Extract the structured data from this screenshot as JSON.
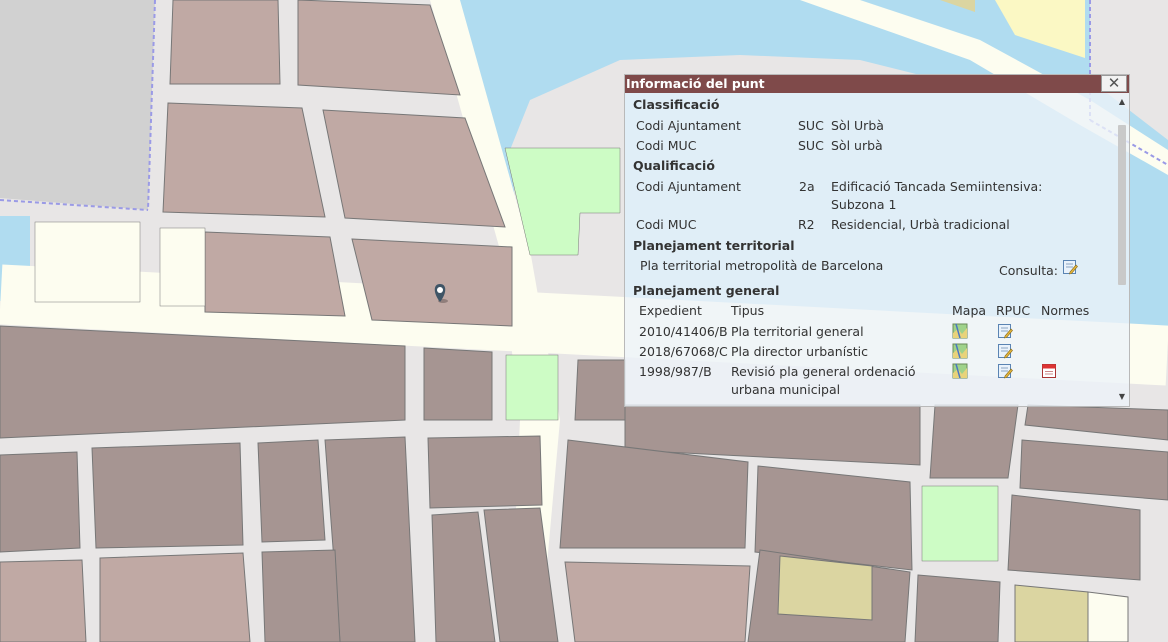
{
  "popup": {
    "title": "Informació del punt",
    "close_glyph": "✕",
    "scroll_up_glyph": "▲",
    "scroll_down_glyph": "▼",
    "classificacio": {
      "heading": "Classificació",
      "rows": [
        {
          "label": "Codi Ajuntament",
          "code": "SUC",
          "desc": "Sòl Urbà"
        },
        {
          "label": "Codi MUC",
          "code": "SUC",
          "desc": "Sòl urbà"
        }
      ]
    },
    "qualificacio": {
      "heading": "Qualificació",
      "rows": [
        {
          "label": "Codi Ajuntament",
          "code": "2a",
          "desc_line1": "Edificació Tancada Semiintensiva:",
          "desc_line2": "Subzona 1"
        },
        {
          "label": "Codi MUC",
          "code": "R2",
          "desc": "Residencial, Urbà tradicional"
        }
      ]
    },
    "territorial": {
      "heading": "Planejament territorial",
      "plan": "Pla territorial metropolità de Barcelona",
      "consulta_label": "Consulta:",
      "consulta_icon": "edit-document-icon"
    },
    "general": {
      "heading": "Planejament general",
      "columns": {
        "expedient": "Expedient",
        "tipus": "Tipus",
        "mapa": "Mapa",
        "rpuc": "RPUC",
        "normes": "Normes"
      },
      "rows": [
        {
          "expedient": "2010/41406/B",
          "tipus": "Pla territorial general"
        },
        {
          "expedient": "2018/67068/C",
          "tipus": "Pla director urbanístic"
        },
        {
          "expedient": "1998/987/B",
          "tipus_line1": "Revisió pla general ordenació",
          "tipus_line2": "urbana municipal"
        }
      ],
      "icons": {
        "mapa": "map-icon",
        "rpuc": "edit-document-icon",
        "normes": "pdf-icon"
      }
    }
  },
  "map": {
    "marker_icon": "location-pin-icon",
    "colors": {
      "street": "#fdfdf0",
      "block_residential": "#c0a9a4",
      "block_dark": "#a69592",
      "water": "#b0dcf0",
      "green": "#cdfcc5",
      "land_grey": "#d1d1d1",
      "pale": "#fdfdf0",
      "beige": "#dbd5a1",
      "boundary": "#9a9ae6",
      "popup_header": "#7f4a4a"
    }
  }
}
